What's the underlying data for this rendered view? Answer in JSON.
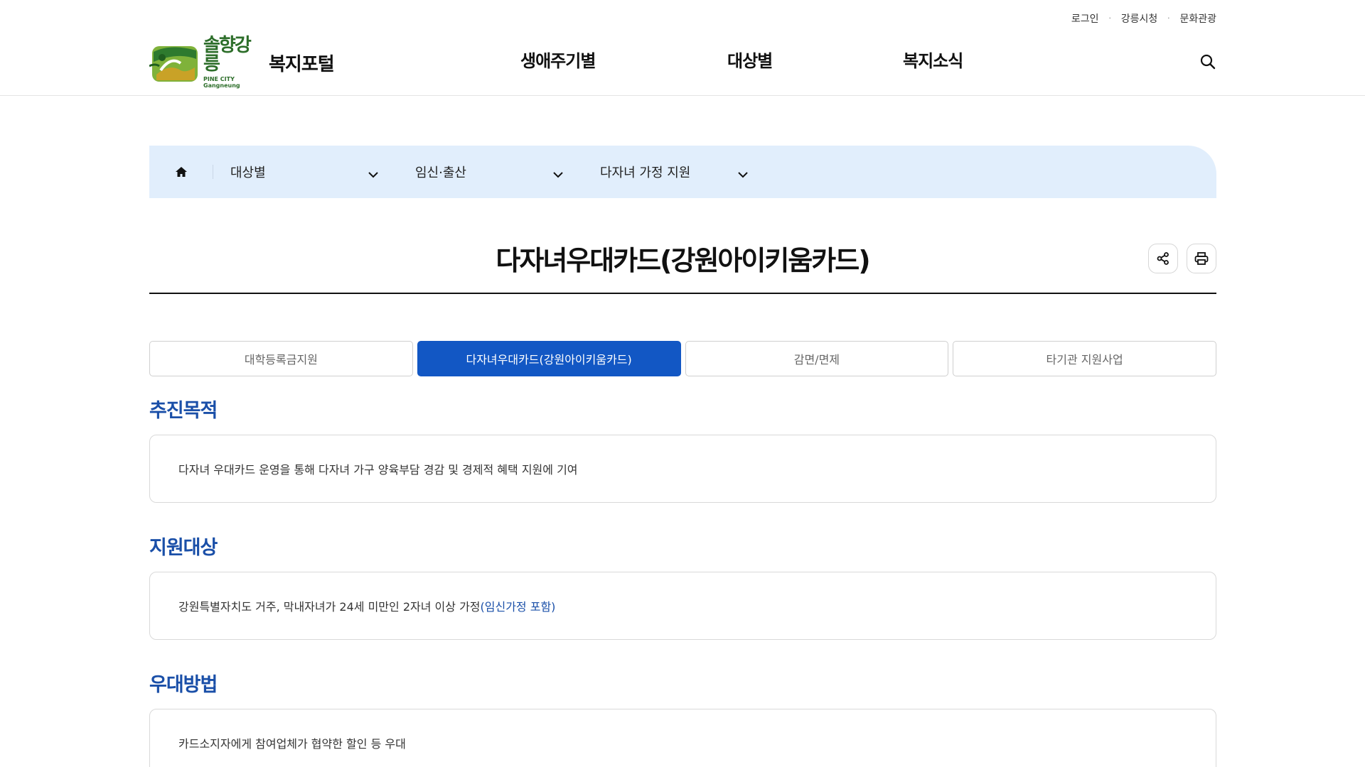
{
  "util_links": [
    "로그인",
    "강릉시청",
    "문화관광"
  ],
  "logo": {
    "city": "솔향강릉",
    "sub": "PINE CITY Gangneung",
    "title": "복지포털"
  },
  "gnb": [
    "생애주기별",
    "대상별",
    "복지소식"
  ],
  "breadcrumb": [
    "대상별",
    "임신·출산",
    "다자녀 가정 지원"
  ],
  "page_title": "다자녀우대카드(강원아이키움카드)",
  "tabs": [
    "대학등록금지원",
    "다자녀우대카드(강원아이키움카드)",
    "감면/면제",
    "타기관 지원사업"
  ],
  "sections": [
    {
      "title": "추진목적",
      "text": "다자녀 우대카드 운영을 통해 다자녀 가구 양육부담 경감 및 경제적 혜택 지원에 기여",
      "highlight": ""
    },
    {
      "title": "지원대상",
      "text": "강원특별자치도 거주, 막내자녀가 24세 미만인 2자녀 이상 가정",
      "highlight": "(임신가정 포함)"
    },
    {
      "title": "우대방법",
      "text": "카드소지자에게 참여업체가 협약한 할인 등 우대",
      "highlight": ""
    }
  ],
  "colors": {
    "accent": "#1257c4",
    "section_title": "#1a4fa8",
    "breadcrumb_bg": "#e1eefc"
  }
}
